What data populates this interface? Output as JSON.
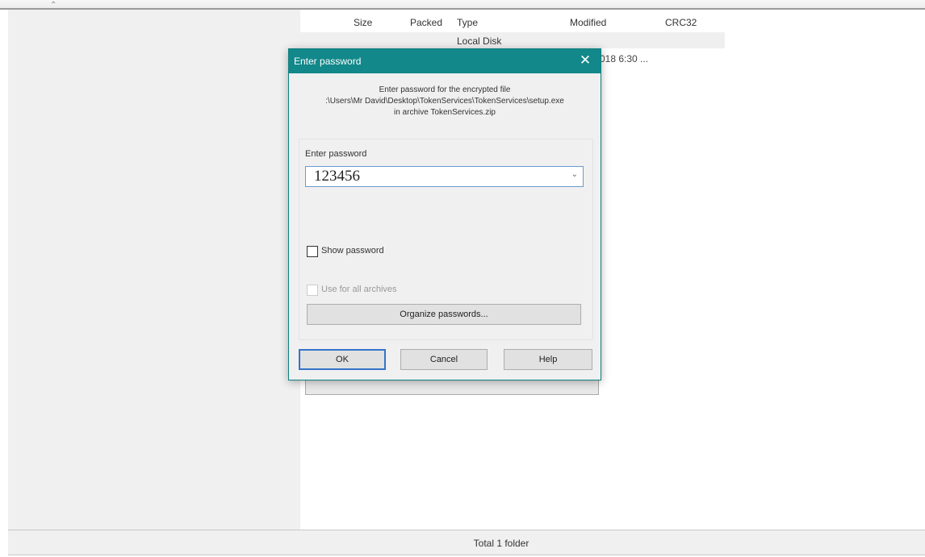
{
  "file_list": {
    "columns": [
      "Size",
      "Packed",
      "Type",
      "Modified",
      "CRC32"
    ],
    "rows": [
      {
        "type": "Local Disk"
      }
    ],
    "partial_modified": "018 6:30 ..."
  },
  "status_bar": {
    "text": "Total 1 folder"
  },
  "dialog": {
    "title": "Enter password",
    "message_line1": "Enter password for the encrypted file",
    "message_line2": ":\\Users\\Mr David\\Desktop\\TokenServices\\TokenServices\\setup.exe",
    "message_line3": "in archive TokenServices.zip",
    "password_label": "Enter password",
    "password_value": "123456",
    "show_password_label": "Show password",
    "show_password_checked": false,
    "use_for_all_label": "Use for all archives",
    "use_for_all_enabled": false,
    "organize_label": "Organize passwords...",
    "ok_label": "OK",
    "cancel_label": "Cancel",
    "help_label": "Help",
    "title_color": "#12888a"
  },
  "icons": {
    "close": "close-icon",
    "chevron": "chevron-down-icon",
    "collapse": "collapse-icon"
  }
}
